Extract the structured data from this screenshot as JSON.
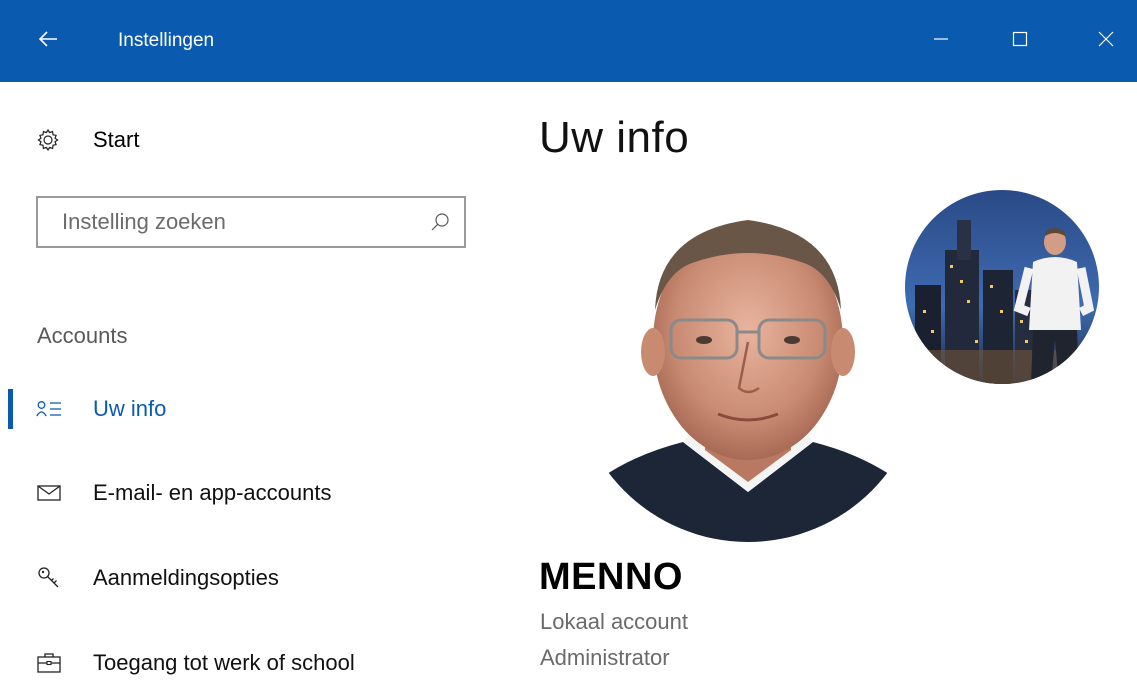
{
  "window": {
    "title": "Instellingen",
    "titlebar_color": "#0a5ab0",
    "controls": [
      "back-arrow-icon",
      "minimize-icon",
      "maximize-icon",
      "close-icon"
    ]
  },
  "sidebar": {
    "home_label": "Start",
    "search": {
      "placeholder": "Instelling zoeken",
      "value": ""
    },
    "section_header": "Accounts",
    "items": [
      {
        "label": "Uw info",
        "icon": "person-list-icon",
        "active": true
      },
      {
        "label": "E-mail- en app-accounts",
        "icon": "mail-icon",
        "active": false
      },
      {
        "label": "Aanmeldingsopties",
        "icon": "key-icon",
        "active": false
      },
      {
        "label": "Toegang tot werk of school",
        "icon": "briefcase-icon",
        "active": false
      }
    ],
    "accent_color": "#0a5ab0"
  },
  "main": {
    "title": "Uw info",
    "user": {
      "name": "MENNO",
      "account_type": "Lokaal account",
      "role": "Administrator"
    }
  }
}
